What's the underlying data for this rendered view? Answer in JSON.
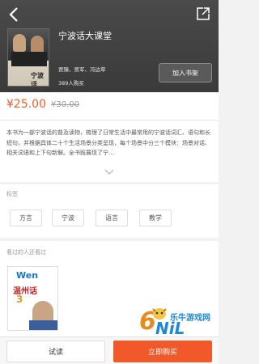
{
  "book": {
    "cover_title": "宁波话",
    "title": "宁波话大课堂",
    "authors": "贾臻、贾军、冯边草",
    "buyers": "389人购买",
    "add_to_shelf": "加入书架"
  },
  "price": {
    "current": "¥25.00",
    "original": "¥30.00"
  },
  "description": "本书为一部宁波话的普及读物，梳理了日常生活中最常用的宁波话词汇、语句和长短句，并根据具体二十个生活场景分类呈现，每个场景中分三个模块：场景对话、相关词语和上下句新解。全书既展现了宁…",
  "tags": {
    "label": "标签",
    "items": [
      "方言",
      "宁波",
      "语言",
      "教学"
    ]
  },
  "also_viewed": {
    "label": "看过的人还看过",
    "cover_text": {
      "wen": "Wen",
      "title": "温州话",
      "number": "3"
    }
  },
  "watermark": {
    "six": "6",
    "nil": "NiL",
    "site": "乐牛游戏网",
    "suffix": ".com"
  },
  "actions": {
    "try_read": "试读",
    "buy_now": "立即购买"
  },
  "colors": {
    "accent": "#f1592a",
    "price": "#f45a2a",
    "hero_bg": "#404040"
  }
}
